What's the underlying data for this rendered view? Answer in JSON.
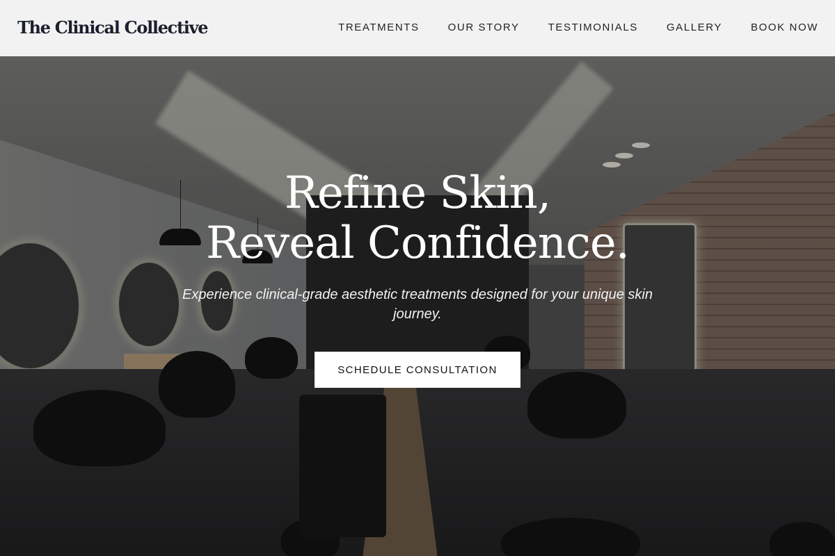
{
  "header": {
    "logo": "The Clinical Collective",
    "nav": [
      {
        "label": "TREATMENTS"
      },
      {
        "label": "OUR STORY"
      },
      {
        "label": "TESTIMONIALS"
      },
      {
        "label": "GALLERY"
      },
      {
        "label": "BOOK NOW"
      }
    ]
  },
  "hero": {
    "headline_line1": "Refine Skin,",
    "headline_line2": "Reveal Confidence.",
    "subtitle": "Experience clinical-grade aesthetic treatments designed for your unique skin journey.",
    "cta_label": "SCHEDULE CONSULTATION",
    "background_image": "salon-interior"
  },
  "colors": {
    "header_bg": "#f2f2f2",
    "logo_text": "#1a1f2c",
    "hero_text": "#ffffff",
    "cta_bg": "#ffffff"
  }
}
